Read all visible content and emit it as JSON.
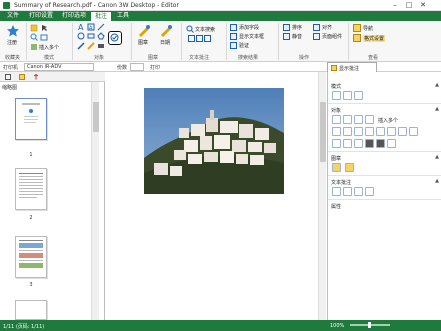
{
  "window": {
    "title": "Summary of Research.pdf - Canon 3W Desktop - Editor",
    "minimize": "–",
    "maximize": "□",
    "close": "✕"
  },
  "menu": {
    "tabs": [
      "文件",
      "打印设置",
      "打印选项",
      "批注",
      "工具"
    ],
    "active_index": 3
  },
  "ribbon": {
    "favorites_label": "注册",
    "favorites_group": "收藏夹",
    "mode_group": "模式",
    "insert_multiple": "插入多个",
    "objects_group": "对象",
    "stamp_label": "图章",
    "stamp_group": "图章",
    "date_label": "日期",
    "text_annot_group": "文本批注",
    "text_search": "文本搜索",
    "search_results_group": "搜索结果",
    "add_text": "添加字段",
    "show_textbox": "显示文本框",
    "verify": "验证",
    "sort": "排序",
    "align": "对齐",
    "flatten": "静音",
    "operations_group": "操作",
    "page_layout": "页面组件",
    "document_group": "查看",
    "nav_label": "导航",
    "pane_settings": "格式设置",
    "accent": "#1f7a3e"
  },
  "props": {
    "printer_label": "打印机",
    "printer_value": "Canon iR-ADV",
    "copies_label": "份数",
    "print_label": "打印",
    "annotation_tab": "显示批注"
  },
  "leftpanel": {
    "title": "缩略图",
    "pages": [
      "1",
      "2",
      "3"
    ]
  },
  "rightpanel": {
    "mode": "模式",
    "objects": "对象",
    "insert_multiple": "插入多个",
    "stamp": "图章",
    "text_annot": "文本批注",
    "properties": "属性"
  },
  "status": {
    "page_info": "1/11 (页码: 1/11)",
    "zoom": "100%"
  }
}
